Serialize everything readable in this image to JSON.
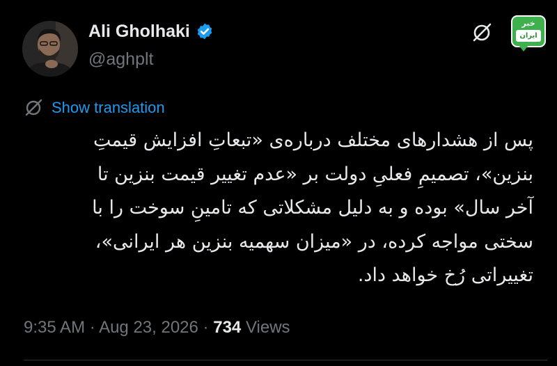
{
  "author": {
    "display_name": "Ali Gholhaki",
    "handle": "@aghplt",
    "verified": true
  },
  "logo": {
    "top_text": "خبر",
    "bottom_text": "ایران"
  },
  "translate": {
    "label": "Show translation"
  },
  "tweet": {
    "text": "پس از هشدارهای مختلف درباره‌ی «تبعاتِ افزایش قیمتِ\nبنزین»، تصمیمِ فعلیِ دولت بر «عدم تغییر قیمت بنزین تا\nآخر سال» بوده و به دلیل مشکلاتی که تامینِ سوخت را با\nسختی مواجه کرده، در «میزان سهمیه بنزین هر ایرانی»،\nتغییراتی رُخ خواهد داد."
  },
  "meta": {
    "time": "9:35 AM",
    "separator": "·",
    "date": "Aug 23, 2026",
    "views_count": "734",
    "views_label": "Views"
  },
  "icons": {
    "verified": "verified-badge-icon",
    "grok": "grok-icon",
    "translate": "translate-icon"
  },
  "colors": {
    "background": "#000000",
    "text": "#e7e9ea",
    "secondary": "#71767b",
    "accent": "#1d9bf0",
    "logo_green": "#3fb04e"
  }
}
